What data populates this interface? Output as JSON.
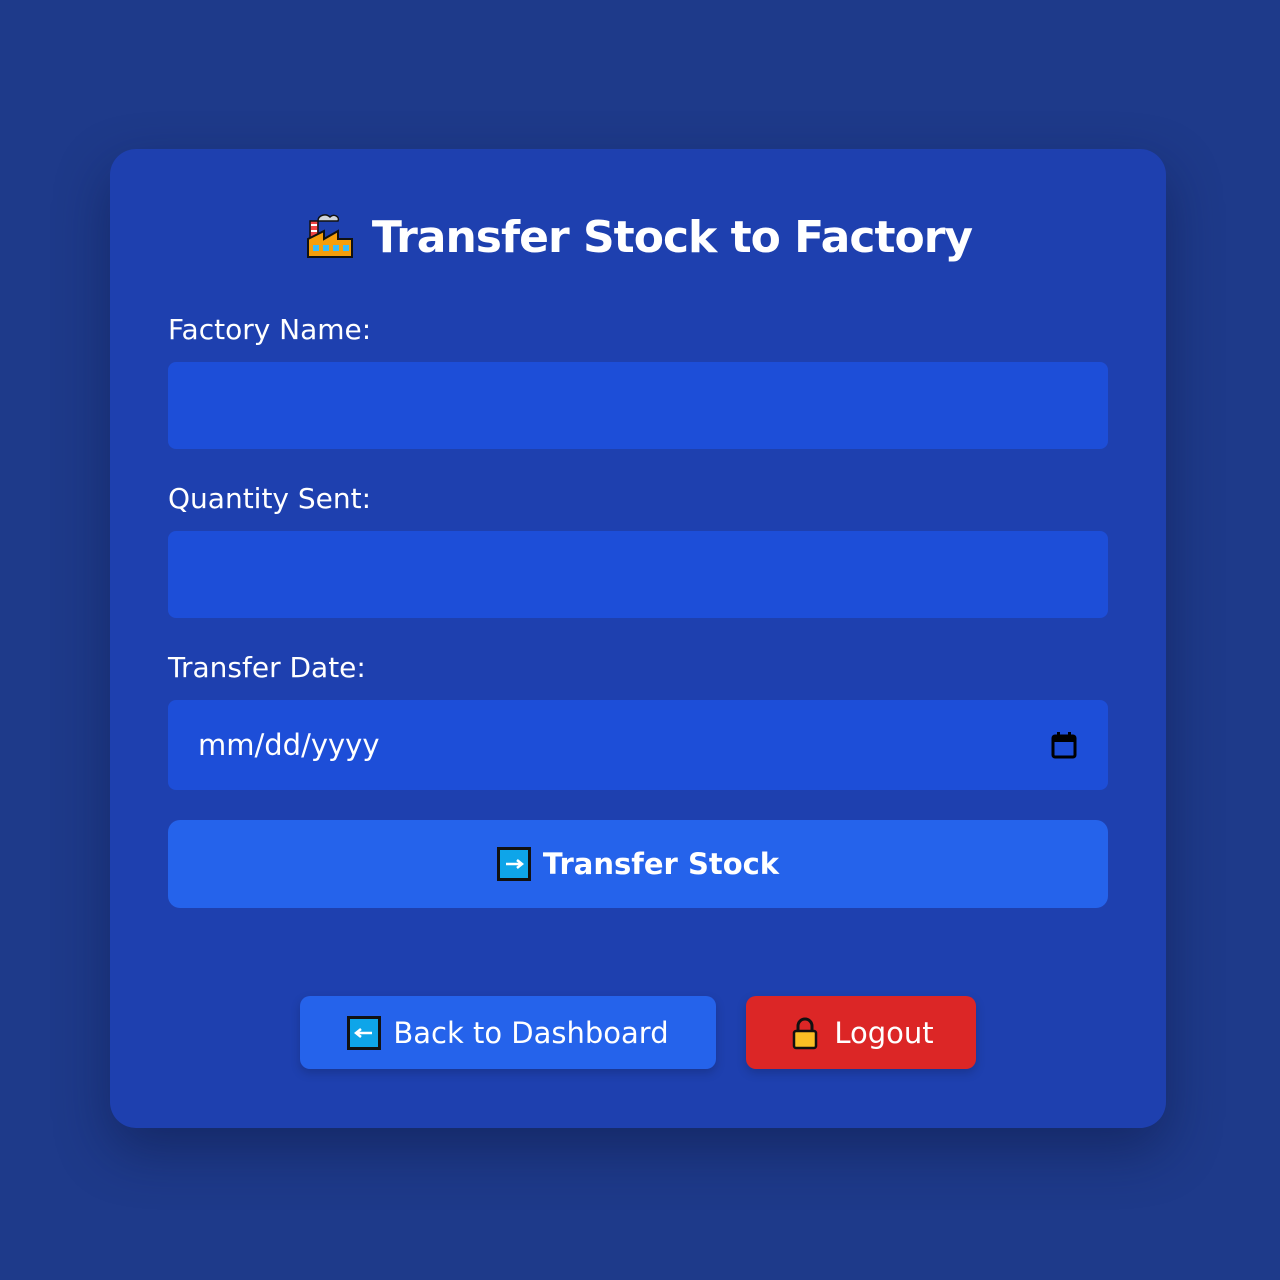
{
  "page": {
    "title": "Transfer Stock to Factory",
    "title_icon": "factory-icon"
  },
  "form": {
    "factory_name": {
      "label": "Factory Name:",
      "value": "",
      "placeholder": ""
    },
    "quantity_sent": {
      "label": "Quantity Sent:",
      "value": "",
      "placeholder": ""
    },
    "transfer_date": {
      "label": "Transfer Date:",
      "placeholder": "mm/dd/yyyy",
      "icon": "calendar-icon"
    },
    "submit": {
      "label": "Transfer Stock",
      "icon": "right-arrow-icon"
    }
  },
  "actions": {
    "back": {
      "label": "Back to Dashboard",
      "icon": "left-arrow-icon"
    },
    "logout": {
      "label": "Logout",
      "icon": "lock-icon"
    }
  },
  "colors": {
    "background": "#1e3a8a",
    "card": "#1e40af",
    "input": "#1d4ed8",
    "primary_button": "#2563eb",
    "logout_button": "#dc2626"
  }
}
